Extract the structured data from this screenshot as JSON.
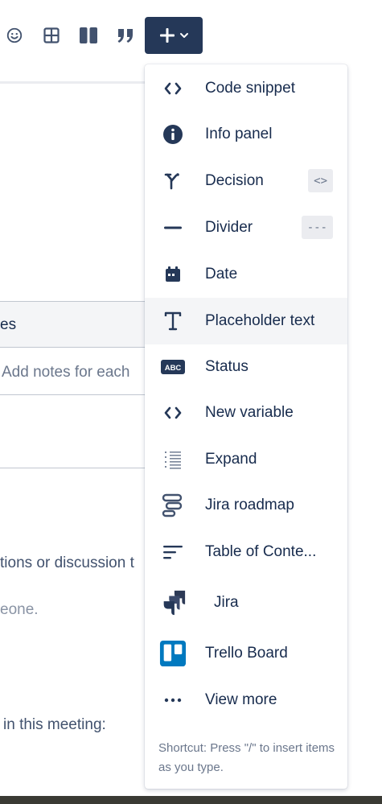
{
  "toolbar": {
    "icons": [
      "emoji-icon",
      "table-icon",
      "layout-icon",
      "quote-icon",
      "plus-icon"
    ]
  },
  "document": {
    "table_header_fragment": "es",
    "cell_placeholder": "Add notes for each",
    "line1": "tions or discussion t",
    "line2": "eone.",
    "line3": "in this meeting:"
  },
  "menu": {
    "items": [
      {
        "label": "Code snippet",
        "icon": "code-icon"
      },
      {
        "label": "Info panel",
        "icon": "info-icon"
      },
      {
        "label": "Decision",
        "icon": "decision-icon",
        "shortcut": "<>"
      },
      {
        "label": "Divider",
        "icon": "divider-icon",
        "shortcut": "---"
      },
      {
        "label": "Date",
        "icon": "calendar-icon"
      },
      {
        "label": "Placeholder text",
        "icon": "text-icon"
      },
      {
        "label": "Status",
        "icon": "status-icon",
        "badge": "ABC"
      },
      {
        "label": "New variable",
        "icon": "variable-icon"
      },
      {
        "label": "Expand",
        "icon": "expand-icon"
      },
      {
        "label": "Jira roadmap",
        "icon": "roadmap-icon"
      },
      {
        "label": "Table of Conte...",
        "icon": "toc-icon"
      },
      {
        "label": "Jira",
        "icon": "jira-icon"
      },
      {
        "label": "Trello Board",
        "icon": "trello-icon"
      },
      {
        "label": "View more",
        "icon": "more-icon"
      }
    ],
    "shortcut_hint": "Shortcut: Press \"/\" to insert items as you type."
  },
  "colors": {
    "primary": "#253858",
    "text": "#172b4d",
    "highlight": "#f4f5f7",
    "trello": "#0079bf"
  }
}
